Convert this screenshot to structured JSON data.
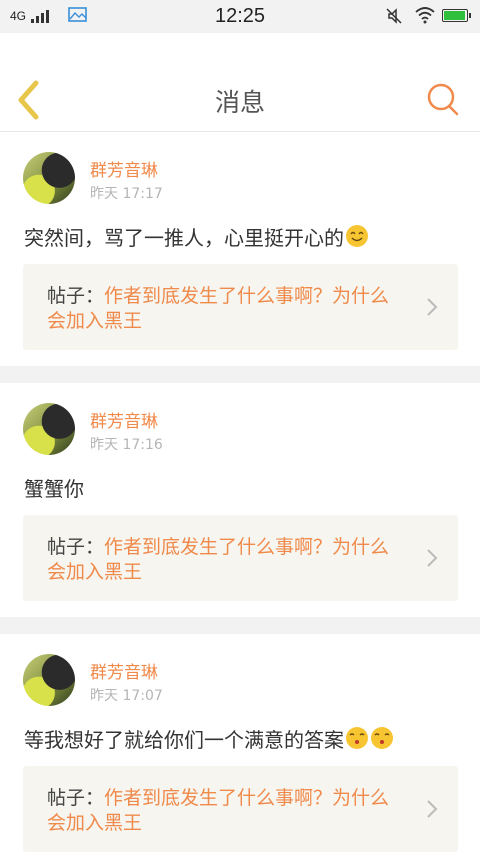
{
  "status_bar": {
    "network": "4G",
    "time": "12:25",
    "battery_color": "#2ec03c"
  },
  "header": {
    "title": "消息"
  },
  "colors": {
    "accent": "#f08a4b",
    "back_icon": "#e8c64a",
    "post_bg": "#f6f5ef"
  },
  "messages": [
    {
      "user": "群芳音琳",
      "time": "昨天 17:17",
      "content": "突然间，骂了一推人，心里挺开心的",
      "emojis": [
        "smile-emoji"
      ],
      "post_prefix": "帖子：",
      "post_title": "作者到底发生了什么事啊？为什么会加入黑王"
    },
    {
      "user": "群芳音琳",
      "time": "昨天 17:16",
      "content": "蟹蟹你",
      "emojis": [],
      "post_prefix": "帖子：",
      "post_title": "作者到底发生了什么事啊？为什么会加入黑王"
    },
    {
      "user": "群芳音琳",
      "time": "昨天 17:07",
      "content": "等我想好了就给你们一个满意的答案",
      "emojis": [
        "kiss-emoji",
        "kiss-emoji"
      ],
      "post_prefix": "帖子：",
      "post_title": "作者到底发生了什么事啊？为什么会加入黑王"
    }
  ]
}
